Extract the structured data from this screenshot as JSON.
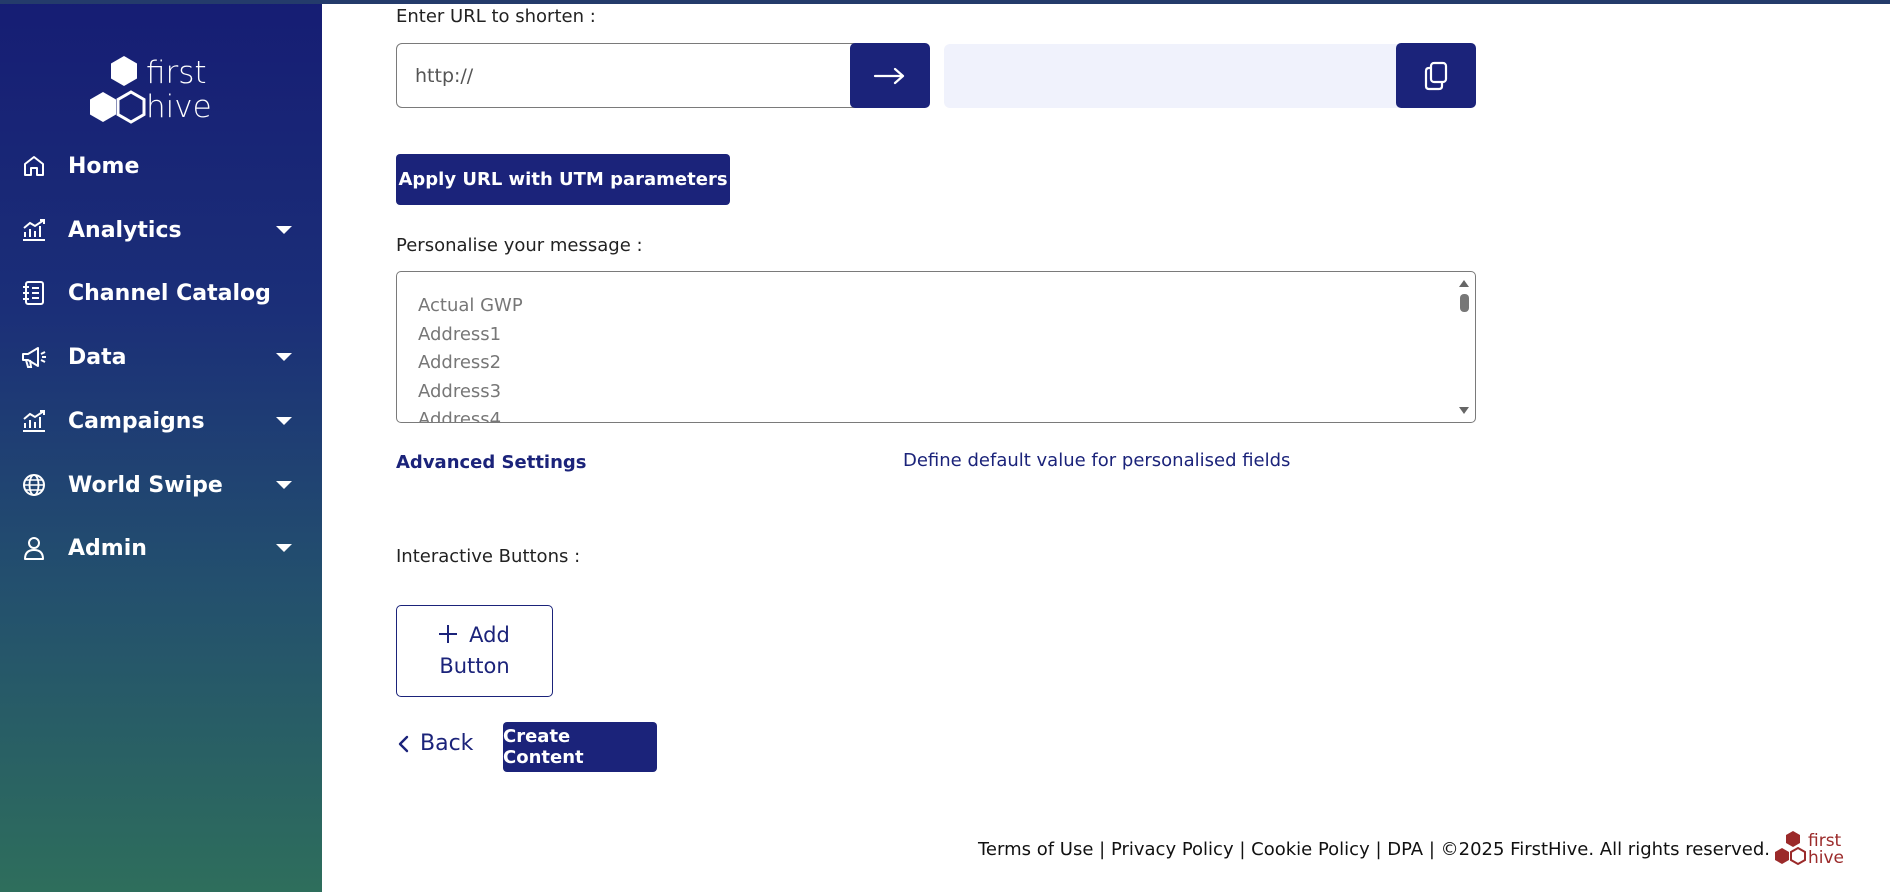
{
  "brand": {
    "logo_text_line1": "first",
    "logo_text_line2": "hive",
    "logo_color": "#ffffff",
    "footer_logo_color": "#9b2a2a"
  },
  "sidebar": {
    "items": [
      {
        "label": "Home",
        "icon": "home-icon",
        "has_caret": false
      },
      {
        "label": "Analytics",
        "icon": "analytics-icon",
        "has_caret": true
      },
      {
        "label": "Channel Catalog",
        "icon": "catalog-icon",
        "has_caret": false
      },
      {
        "label": "Data",
        "icon": "megaphone-icon",
        "has_caret": true
      },
      {
        "label": "Campaigns",
        "icon": "campaigns-icon",
        "has_caret": true
      },
      {
        "label": "World Swipe",
        "icon": "globe-icon",
        "has_caret": true
      },
      {
        "label": "Admin",
        "icon": "user-icon",
        "has_caret": true
      }
    ]
  },
  "form": {
    "url_label": "Enter URL to shorten :",
    "url_placeholder": "http://",
    "utm_button": "Apply URL with UTM parameters",
    "personalise_label": "Personalise your message :",
    "personalise_fields": [
      "Actual GWP",
      "Address1",
      "Address2",
      "Address3",
      "Address4"
    ],
    "advanced_settings": "Advanced Settings",
    "define_default": "Define default value for personalised fields",
    "interactive_label": "Interactive Buttons :",
    "add_button_line1": "Add",
    "add_button_line2": "Button",
    "back_label": "Back",
    "create_button": "Create Content"
  },
  "footer": {
    "terms": "Terms of Use",
    "privacy": "Privacy Policy",
    "cookie": "Cookie Policy",
    "dpa": "DPA",
    "copyright": "©2025 FirstHive. All rights reserved.",
    "separator": " | "
  },
  "colors": {
    "primary": "#1b237a",
    "sidebar_top": "#161d74",
    "sidebar_bottom": "#2e6e5c"
  }
}
